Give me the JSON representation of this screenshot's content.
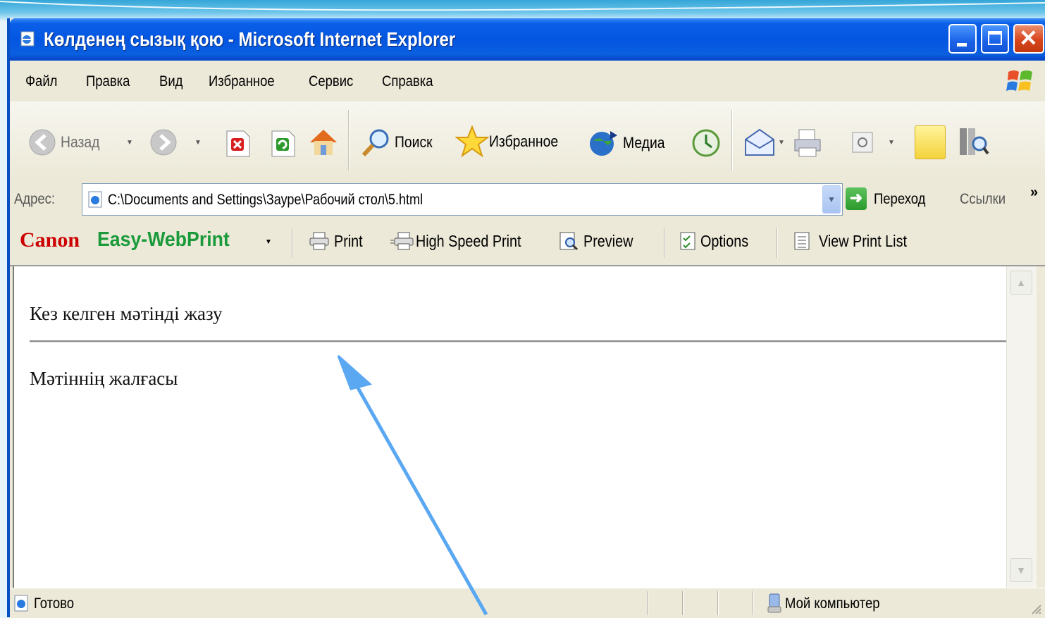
{
  "window": {
    "title": "Көлденең сызық қою - Microsoft Internet Explorer"
  },
  "menu": [
    "Файл",
    "Правка",
    "Вид",
    "Избранное",
    "Сервис",
    "Справка"
  ],
  "toolbar": {
    "back": "Назад",
    "search": "Поиск",
    "favorites": "Избранное",
    "media": "Медиа"
  },
  "address": {
    "label": "Адрес:",
    "value": "C:\\Documents and Settings\\Зауре\\Рабочий стол\\5.html",
    "go": "Переход",
    "links": "Ссылки"
  },
  "canon": {
    "brand": "Canon",
    "product": "Easy-WebPrint",
    "print": "Print",
    "high_speed_print": "High Speed Print",
    "preview": "Preview",
    "options": "Options",
    "view_print_list": "View Print List"
  },
  "content": {
    "line1": "Кез келген мәтінді жазу",
    "line2": "Мәтіннің жалғасы"
  },
  "status": {
    "text": "Готово",
    "zone": "Мой компьютер"
  },
  "colors": {
    "titlebar": "#0456e0",
    "canon_red": "#cc0000",
    "easy_green": "#1a9a3a",
    "annotation_arrow": "#5aa8f2"
  }
}
